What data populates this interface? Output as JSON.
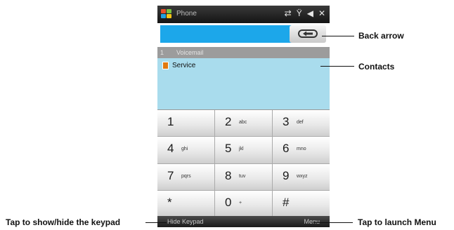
{
  "titlebar": {
    "title": "Phone",
    "icons": [
      "signal-icon",
      "network-icon",
      "speaker-icon",
      "close-icon"
    ]
  },
  "dial": {
    "value": ""
  },
  "list": {
    "header_number": "1",
    "header_label": "Voicemail",
    "contacts": [
      {
        "label": "Service"
      }
    ]
  },
  "keypad": {
    "keys": [
      {
        "digit": "1",
        "letters": ""
      },
      {
        "digit": "2",
        "letters": "abc"
      },
      {
        "digit": "3",
        "letters": "def"
      },
      {
        "digit": "4",
        "letters": "ghi"
      },
      {
        "digit": "5",
        "letters": "jkl"
      },
      {
        "digit": "6",
        "letters": "mno"
      },
      {
        "digit": "7",
        "letters": "pqrs"
      },
      {
        "digit": "8",
        "letters": "tuv"
      },
      {
        "digit": "9",
        "letters": "wxyz"
      },
      {
        "digit": "*",
        "letters": ""
      },
      {
        "digit": "0",
        "letters": "+"
      },
      {
        "digit": "#",
        "letters": ""
      }
    ]
  },
  "softkeys": {
    "left": "Hide Keypad",
    "right": "Menu"
  },
  "callouts": {
    "back_arrow": "Back arrow",
    "contacts": "Contacts",
    "keypad_toggle": "Tap to show/hide the keypad",
    "menu": "Tap to launch Menu"
  }
}
